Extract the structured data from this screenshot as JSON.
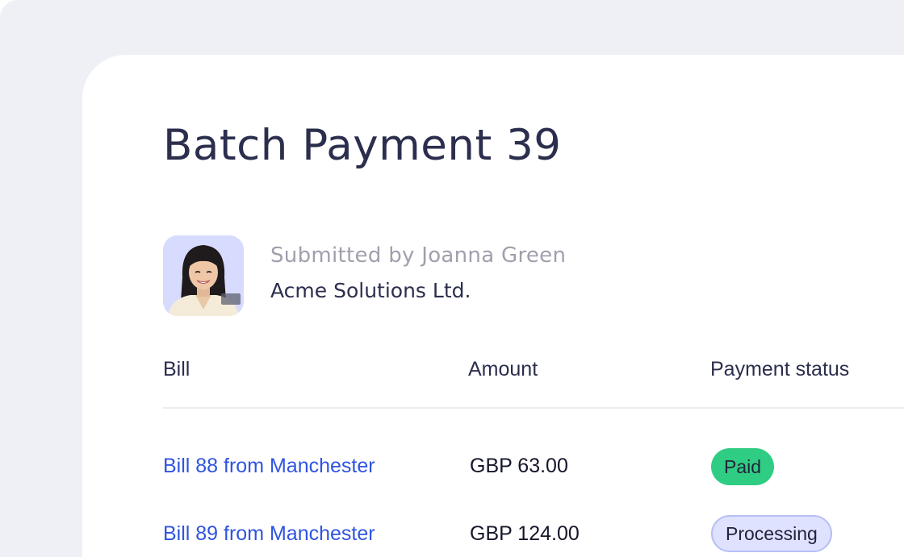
{
  "page": {
    "title": "Batch Payment 39"
  },
  "submitter": {
    "submitted_by": "Submitted by Joanna Green",
    "company": "Acme Solutions Ltd.",
    "avatar_icon": "user-photo"
  },
  "table": {
    "columns": [
      "Bill",
      "Amount",
      "Payment status"
    ],
    "rows": [
      {
        "bill": "Bill 88 from Manchester",
        "amount": "GBP 63.00",
        "status": "Paid"
      },
      {
        "bill": "Bill 89 from Manchester",
        "amount": "GBP 124.00",
        "status": "Processing"
      }
    ]
  },
  "colors": {
    "background": "#eff0f5",
    "card": "#ffffff",
    "heading": "#2b2e4d",
    "link": "#2f54e0",
    "status_paid": "#2fcd83",
    "status_processing": "#dfe2ff"
  }
}
